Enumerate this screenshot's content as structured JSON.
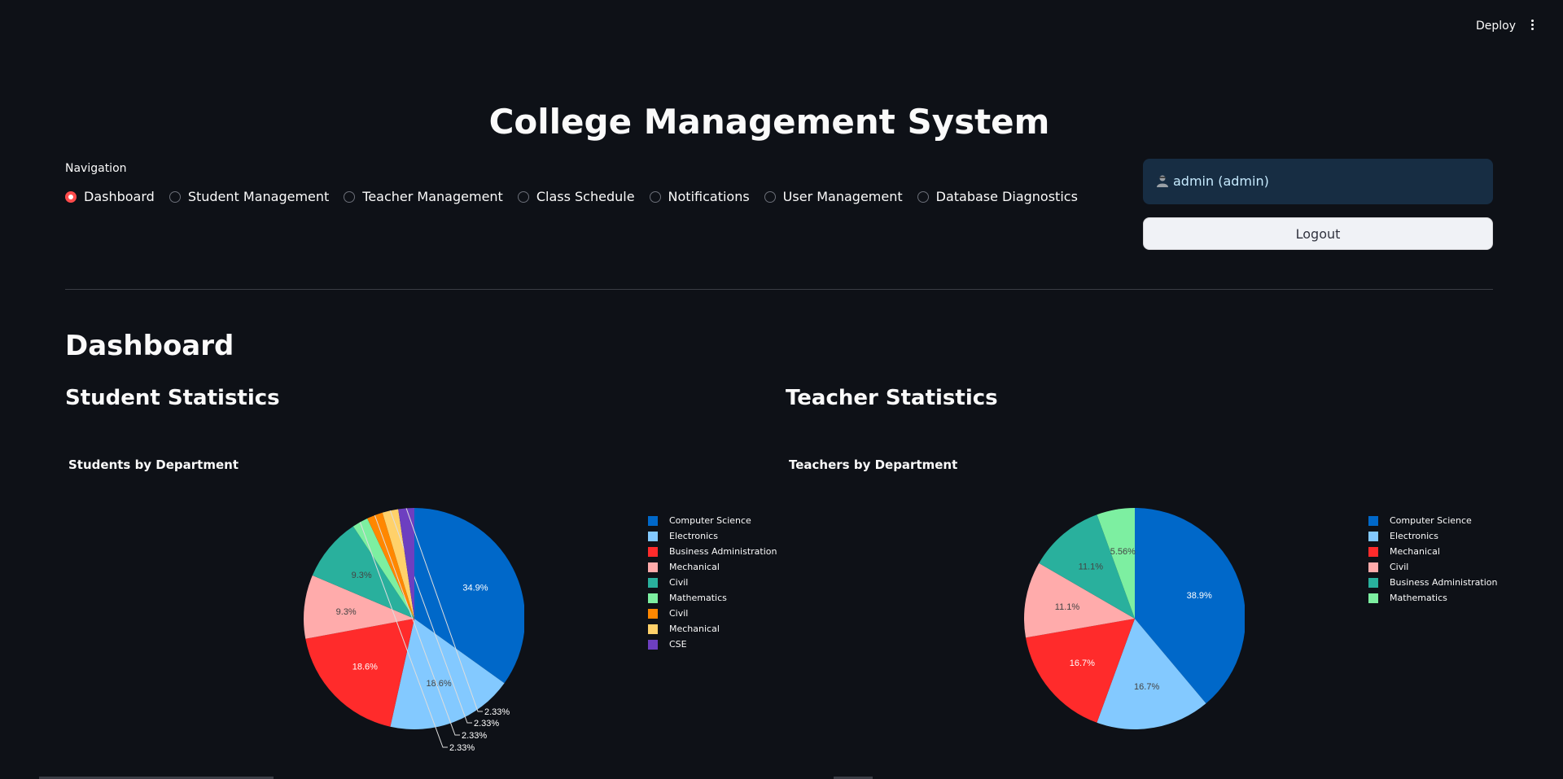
{
  "header": {
    "deploy_label": "Deploy"
  },
  "app_title": "College Management System",
  "navigation": {
    "label": "Navigation",
    "options": [
      {
        "label": "Dashboard",
        "selected": true
      },
      {
        "label": "Student Management",
        "selected": false
      },
      {
        "label": "Teacher Management",
        "selected": false
      },
      {
        "label": "Class Schedule",
        "selected": false
      },
      {
        "label": "Notifications",
        "selected": false
      },
      {
        "label": "User Management",
        "selected": false
      },
      {
        "label": "Database Diagnostics",
        "selected": false
      }
    ]
  },
  "user": {
    "display": "admin (admin)",
    "logout_label": "Logout"
  },
  "dashboard": {
    "title": "Dashboard",
    "student_heading": "Student Statistics",
    "teacher_heading": "Teacher Statistics"
  },
  "chart_data": [
    {
      "type": "pie",
      "title": "Students by Department",
      "slices": [
        {
          "label": "Computer Science",
          "value": 34.9,
          "display": "34.9%",
          "color": "#0068c9"
        },
        {
          "label": "Electronics",
          "value": 18.6,
          "display": "18.6%",
          "color": "#83c9ff"
        },
        {
          "label": "Business Administration",
          "value": 18.6,
          "display": "18.6%",
          "color": "#ff2b2b"
        },
        {
          "label": "Mechanical",
          "value": 9.3,
          "display": "9.3%",
          "color": "#ffabab"
        },
        {
          "label": "Civil",
          "value": 9.3,
          "display": "9.3%",
          "color": "#29b09d"
        },
        {
          "label": "Mathematics",
          "value": 2.33,
          "display": "2.33%",
          "color": "#7defa1"
        },
        {
          "label": "Civil",
          "value": 2.33,
          "display": "2.33%",
          "color": "#ff8700"
        },
        {
          "label": "Mechanical",
          "value": 2.33,
          "display": "2.33%",
          "color": "#ffd16a"
        },
        {
          "label": "CSE",
          "value": 2.33,
          "display": "2.33%",
          "color": "#6d3fc0"
        }
      ]
    },
    {
      "type": "pie",
      "title": "Teachers by Department",
      "slices": [
        {
          "label": "Computer Science",
          "value": 38.9,
          "display": "38.9%",
          "color": "#0068c9"
        },
        {
          "label": "Electronics",
          "value": 16.7,
          "display": "16.7%",
          "color": "#83c9ff"
        },
        {
          "label": "Mechanical",
          "value": 16.7,
          "display": "16.7%",
          "color": "#ff2b2b"
        },
        {
          "label": "Civil",
          "value": 11.1,
          "display": "11.1%",
          "color": "#ffabab"
        },
        {
          "label": "Business Administration",
          "value": 11.1,
          "display": "11.1%",
          "color": "#29b09d"
        },
        {
          "label": "Mathematics",
          "value": 5.56,
          "display": "5.56%",
          "color": "#7defa1"
        }
      ]
    }
  ]
}
